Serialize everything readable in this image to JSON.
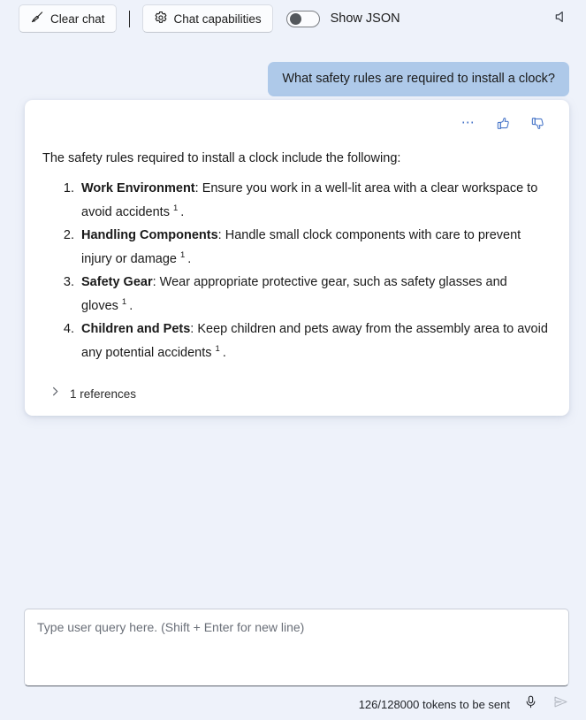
{
  "toolbar": {
    "clear_chat_label": "Clear chat",
    "clear_chat_icon": "broom-icon",
    "chat_capabilities_label": "Chat capabilities",
    "chat_capabilities_icon": "gear-icon",
    "show_json_label": "Show JSON",
    "show_json_toggle_state": "off",
    "speaker_icon": "speaker-mute-icon"
  },
  "conversation": {
    "user_message": "What safety rules are required to install a clock?",
    "assistant": {
      "actions": {
        "more_icon": "ellipsis-icon",
        "thumbs_up_icon": "thumbs-up-icon",
        "thumbs_down_icon": "thumbs-down-icon"
      },
      "intro": "The safety rules required to install a clock include the following:",
      "items": [
        {
          "title": "Work Environment",
          "text": ": Ensure you work in a well-lit area with a clear workspace to avoid accidents",
          "citation": "1",
          "tail": "."
        },
        {
          "title": "Handling Components",
          "text": ": Handle small clock components with care to prevent injury or damage",
          "citation": "1",
          "tail": "."
        },
        {
          "title": "Safety Gear",
          "text": ": Wear appropriate protective gear, such as safety glasses and gloves",
          "citation": "1",
          "tail": "."
        },
        {
          "title": "Children and Pets",
          "text": ": Keep children and pets away from the assembly area to avoid any potential accidents",
          "citation": "1",
          "tail": "."
        }
      ],
      "references_label": "1 references",
      "references_expanded": false,
      "references_icon": "chevron-right-icon"
    }
  },
  "composer": {
    "placeholder": "Type user query here. (Shift + Enter for new line)",
    "value": "",
    "token_status": "126/128000 tokens to be sent",
    "mic_icon": "microphone-icon",
    "send_icon": "send-icon"
  },
  "colors": {
    "page_background": "#eef2fa",
    "user_bubble": "#aec9e9",
    "card_background": "#ffffff",
    "accent_blue": "#4a77c9",
    "text_primary": "#1a1a1a"
  }
}
